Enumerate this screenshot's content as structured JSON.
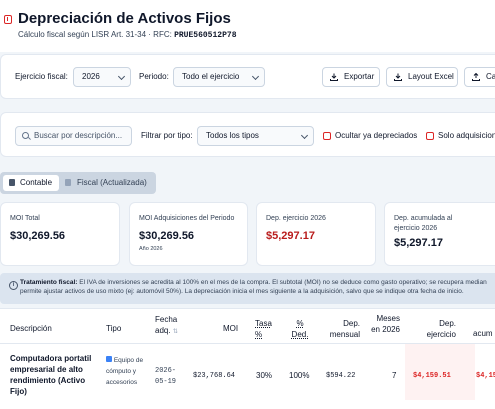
{
  "header": {
    "title": "Depreciación de Activos Fijos",
    "subtitle_prefix": "Cálculo fiscal según LISR Art. 31-34 · RFC:",
    "rfc": "PRUE560512P78"
  },
  "toolbar": {
    "ejercicio_label": "Ejercicio fiscal:",
    "ejercicio_value": "2026",
    "periodo_label": "Periodo:",
    "periodo_value": "Todo el ejercicio",
    "exportar_label": "Exportar",
    "layout_label": "Layout Excel",
    "cargar_label": "Car"
  },
  "filters": {
    "search_placeholder": "Buscar por descripción...",
    "tipo_label": "Filtrar por tipo:",
    "tipo_value": "Todos los tipos",
    "ocultar_label": "Ocultar ya depreciados",
    "solo_label": "Solo adquisicion"
  },
  "view_toggle": {
    "contable": "Contable",
    "fiscal": "Fiscal (Actualizada)"
  },
  "kpis": [
    {
      "label": "MOI Total",
      "value": "$30,269.56",
      "sub": ""
    },
    {
      "label": "MOI Adquisiciones del Periodo",
      "value": "$30,269.56",
      "sub": "Año 2026"
    },
    {
      "label": "Dep. ejercicio 2026",
      "value": "$5,297.17",
      "sub": ""
    },
    {
      "label": "Dep. acumulada al ejercicio 2026",
      "value": "$5,297.17",
      "sub": ""
    }
  ],
  "notice": {
    "title": "Tratamiento fiscal:",
    "text": "El IVA de inversiones se acredita al 100% en el mes de la compra. El subtotal (MOI) no se deduce como gasto operativo; se recupera median permite ajustar activos de uso mixto (ej: automóvil 50%). La depreciación inicia el mes siguiente a la adquisición, salvo que se indique otra fecha de inicio."
  },
  "table": {
    "headers": {
      "descripcion": "Descripción",
      "tipo": "Tipo",
      "fecha": "Fecha adq.",
      "moi": "MOI",
      "tasa": "Tasa %",
      "ded": "% Ded.",
      "dep_mensual": "Dep. mensual",
      "meses": "Meses en 2026",
      "dep_ejercicio": "Dep. ejercicio",
      "acum": "acum"
    },
    "rows": [
      {
        "descripcion": "Computadora portatil empresarial de alto rendimiento (Activo Fijo)",
        "tipo": "Equipo de cómputo y accesorios",
        "fecha": "2026-05-19",
        "moi": "$23,768.64",
        "tasa": "30%",
        "ded": "100%",
        "dep_mensual": "$594.22",
        "meses": "7",
        "dep_ejercicio": "$4,159.51",
        "acum": "$4,15"
      }
    ]
  },
  "colors": {
    "accent_red": "#dc2626",
    "page_bg": "#f1f5f9",
    "notice_bg": "#dbe4ef"
  }
}
